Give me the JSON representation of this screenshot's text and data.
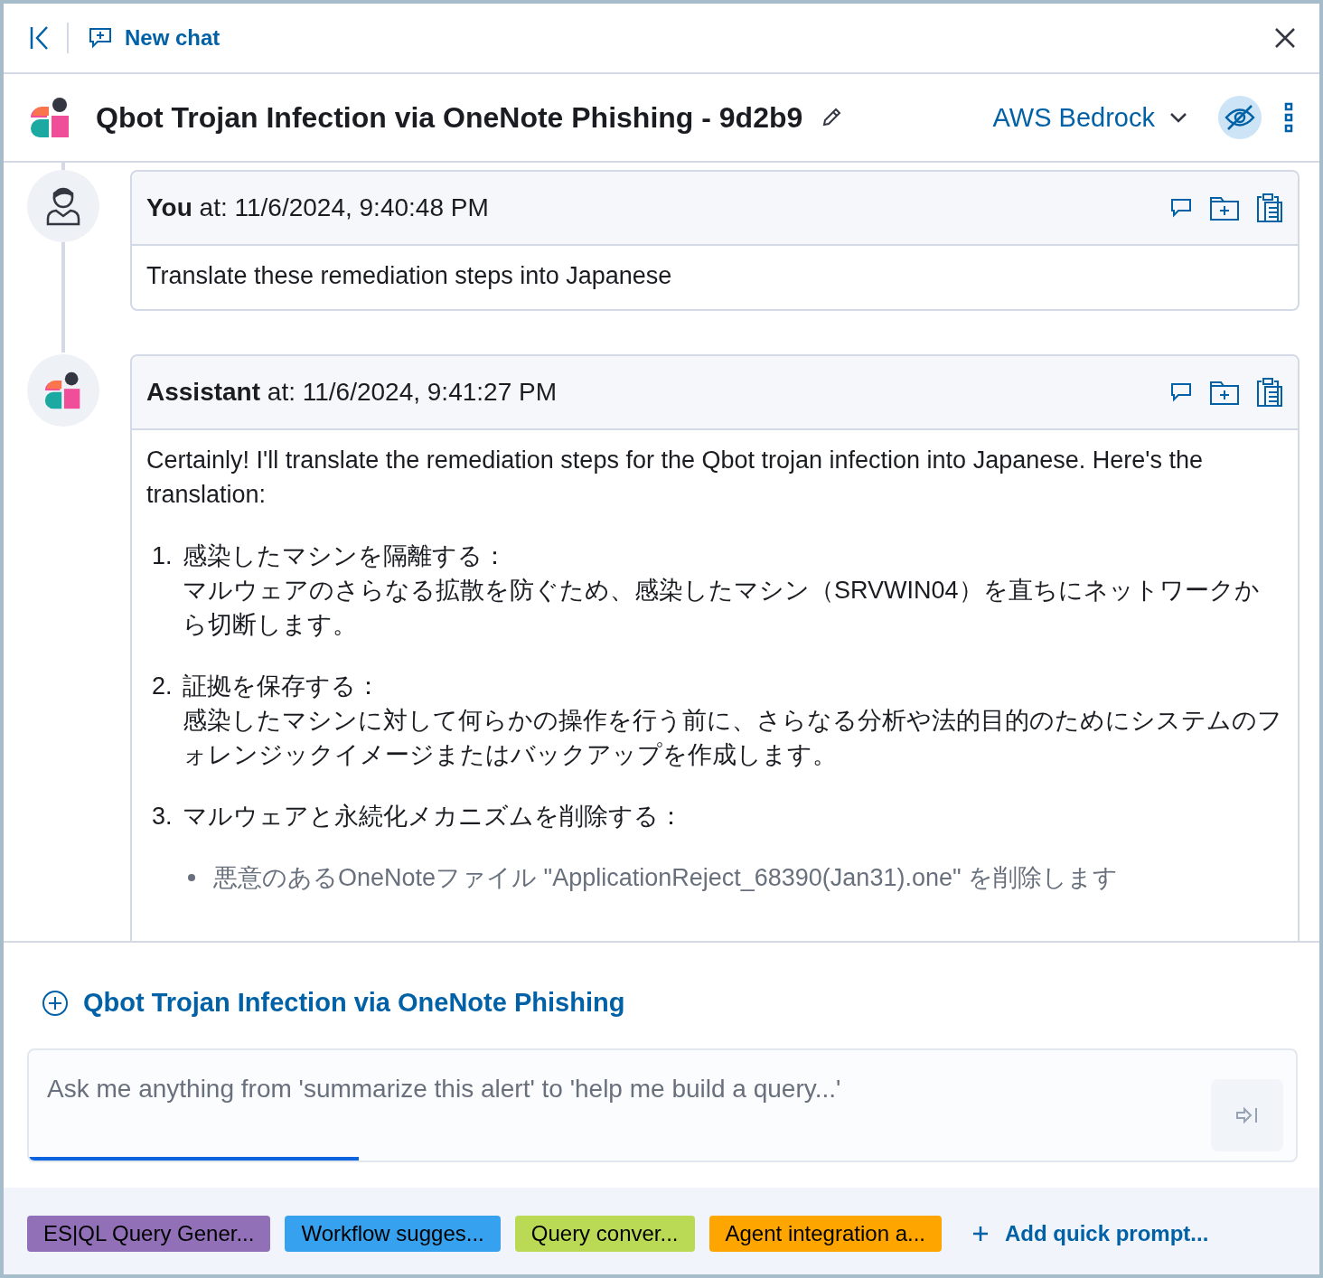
{
  "header": {
    "new_chat": "New chat"
  },
  "conversation": {
    "title": "Qbot Trojan Infection via OneNote Phishing - 9d2b9",
    "connector": "AWS Bedrock",
    "anonymize": {
      "on": true
    }
  },
  "messages": [
    {
      "kind": "user",
      "author": "You",
      "timestamp": "at: 11/6/2024, 9:40:48 PM",
      "content": [
        {
          "kind": "paragraph",
          "text": "Translate these remediation steps into Japanese"
        }
      ]
    },
    {
      "kind": "assistant",
      "author": "Assistant",
      "timestamp": "at: 11/6/2024, 9:41:27 PM",
      "content": [
        {
          "kind": "paragraph",
          "text": "Certainly! I'll translate the remediation steps for the Qbot trojan infection into Japanese. Here's the translation:"
        },
        {
          "kind": "step",
          "number": "1.",
          "title": "感染したマシンを隔離する：",
          "text": "マルウェアのさらなる拡散を防ぐため、感染したマシン（SRVWIN04）を直ちにネットワークから切断します。"
        },
        {
          "kind": "step",
          "number": "2.",
          "title": "証拠を保存する：",
          "text": "感染したマシンに対して何らかの操作を行う前に、さらなる分析や法的目的のためにシステムのフォレンジックイメージまたはバックアップを作成します。"
        },
        {
          "kind": "step",
          "number": "3.",
          "title": "マルウェアと永続化メカニズムを削除する："
        },
        {
          "kind": "bullet",
          "text": "悪意のあるOneNoteファイル \"ApplicationReject_68390(Jan31).one\" を削除します"
        }
      ]
    }
  ],
  "context": {
    "label": "Qbot Trojan Infection via OneNote Phishing"
  },
  "input": {
    "placeholder": "Ask me anything from 'summarize this alert' to 'help me build a query...'",
    "level": 0.26
  },
  "quick_prompts": [
    {
      "label": "ES|QL Query Gener...",
      "color": "#9170b8"
    },
    {
      "label": "Workflow sugges...",
      "color": "#36a2ef"
    },
    {
      "label": "Query conver...",
      "color": "#bada55"
    },
    {
      "label": "Agent integration a...",
      "color": "#ffa500"
    }
  ],
  "add_quick_prompt": "Add quick prompt..."
}
